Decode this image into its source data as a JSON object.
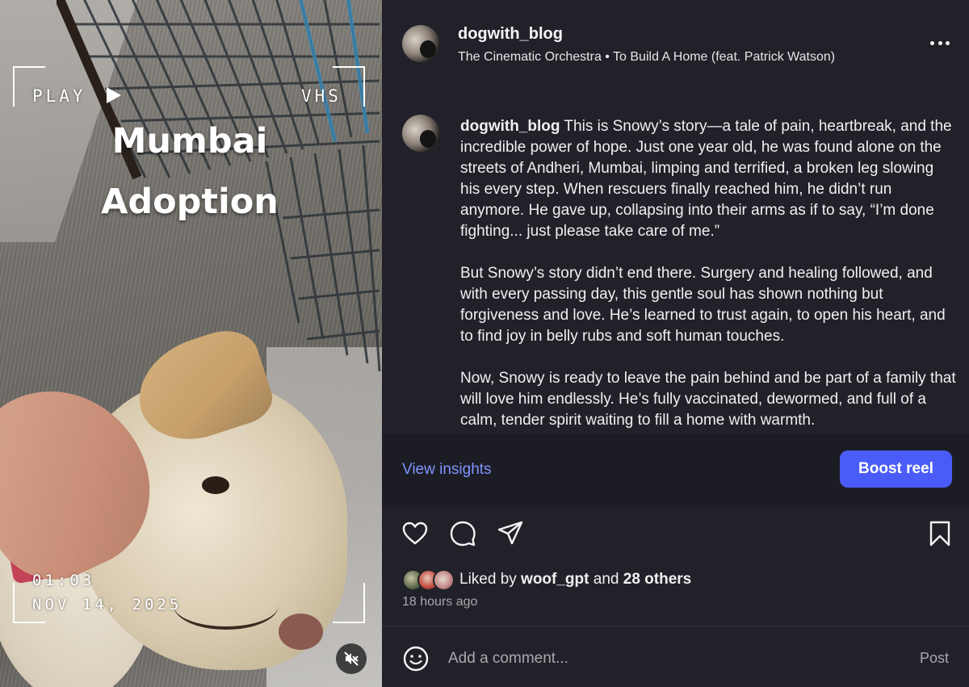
{
  "video": {
    "overlay_play": "PLAY",
    "overlay_vhs": "VHS",
    "title_line1": "Mumbai",
    "title_line2": "Adoption",
    "timecode": "01:03",
    "date": "NOV 14, 2025",
    "mute_icon": "speaker-muted-icon"
  },
  "post": {
    "username": "dogwith_blog",
    "audio": "The Cinematic Orchestra • To Build A Home (feat. Patrick Watson)",
    "more_icon": "more-options-icon",
    "caption_username": "dogwith_blog",
    "caption_paragraphs": [
      "This is Snowy’s story—a tale of pain, heartbreak, and the incredible power of hope. Just one year old, he was found alone on the streets of Andheri, Mumbai, limping and terrified, a broken leg slowing his every step. When rescuers finally reached him, he didn’t run anymore. He gave up, collapsing into their arms as if to say, “I’m done fighting... just please take care of me.”",
      "But Snowy’s story didn’t end there. Surgery and healing followed, and with every passing day, this gentle soul has shown nothing but forgiveness and love. He’s learned to trust again, to open his heart, and to find joy in belly rubs and soft human touches.",
      "Now, Snowy is ready to leave the pain behind and be part of a family that will love him endlessly. He’s fully vaccinated, dewormed, and full of a calm, tender spirit waiting to fill a home with warmth."
    ],
    "view_insights": "View insights",
    "boost_reel": "Boost reel",
    "liked_prefix": "Liked by ",
    "liked_user": "woof_gpt",
    "liked_middle": " and ",
    "liked_others": "28 others",
    "time_ago": "18 hours ago",
    "comment_placeholder": "Add a comment...",
    "post_label": "Post"
  },
  "colors": {
    "panel_bg": "#212229",
    "accent_link": "#7f94ff",
    "boost_button": "#4a5cf7"
  },
  "icons": [
    "heart-icon",
    "comment-icon",
    "share-icon",
    "bookmark-icon",
    "emoji-icon"
  ]
}
